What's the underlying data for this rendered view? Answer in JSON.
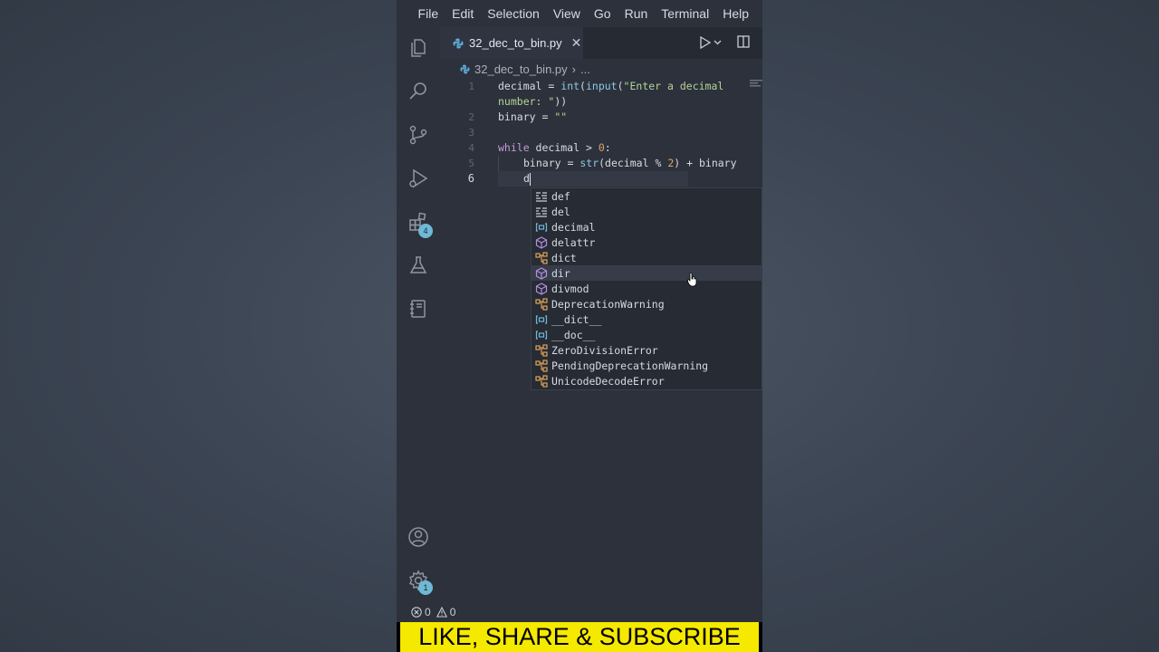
{
  "menu": {
    "items": [
      "File",
      "Edit",
      "Selection",
      "View",
      "Go",
      "Run",
      "Terminal",
      "Help"
    ]
  },
  "activity_bar": {
    "extensions_badge": "4",
    "settings_badge": "1"
  },
  "tab": {
    "label": "32_dec_to_bin.py",
    "close": "✕"
  },
  "breadcrumb": {
    "file": "32_dec_to_bin.py",
    "sep": "›",
    "more": "..."
  },
  "editor": {
    "line_numbers": [
      "1",
      "2",
      "3",
      "4",
      "5",
      "6"
    ],
    "typed": "d"
  },
  "suggest": {
    "items": [
      {
        "label": "def",
        "kind": "keyword"
      },
      {
        "label": "del",
        "kind": "keyword"
      },
      {
        "label": "decimal",
        "kind": "variable"
      },
      {
        "label": "delattr",
        "kind": "function"
      },
      {
        "label": "dict",
        "kind": "class"
      },
      {
        "label": "dir",
        "kind": "function"
      },
      {
        "label": "divmod",
        "kind": "function"
      },
      {
        "label": "DeprecationWarning",
        "kind": "class"
      },
      {
        "label": "__dict__",
        "kind": "variable"
      },
      {
        "label": "__doc__",
        "kind": "variable"
      },
      {
        "label": "ZeroDivisionError",
        "kind": "class"
      },
      {
        "label": "PendingDeprecationWarning",
        "kind": "class"
      },
      {
        "label": "UnicodeDecodeError",
        "kind": "class"
      }
    ],
    "selected_label": "dir"
  },
  "status": {
    "errors": "0",
    "warnings": "0"
  },
  "banner": {
    "text": "LIKE, SHARE & SUBSCRIBE"
  },
  "colors": {
    "background": "#2c313b",
    "accent": "#6fb8d6",
    "banner": "#f5e900"
  }
}
